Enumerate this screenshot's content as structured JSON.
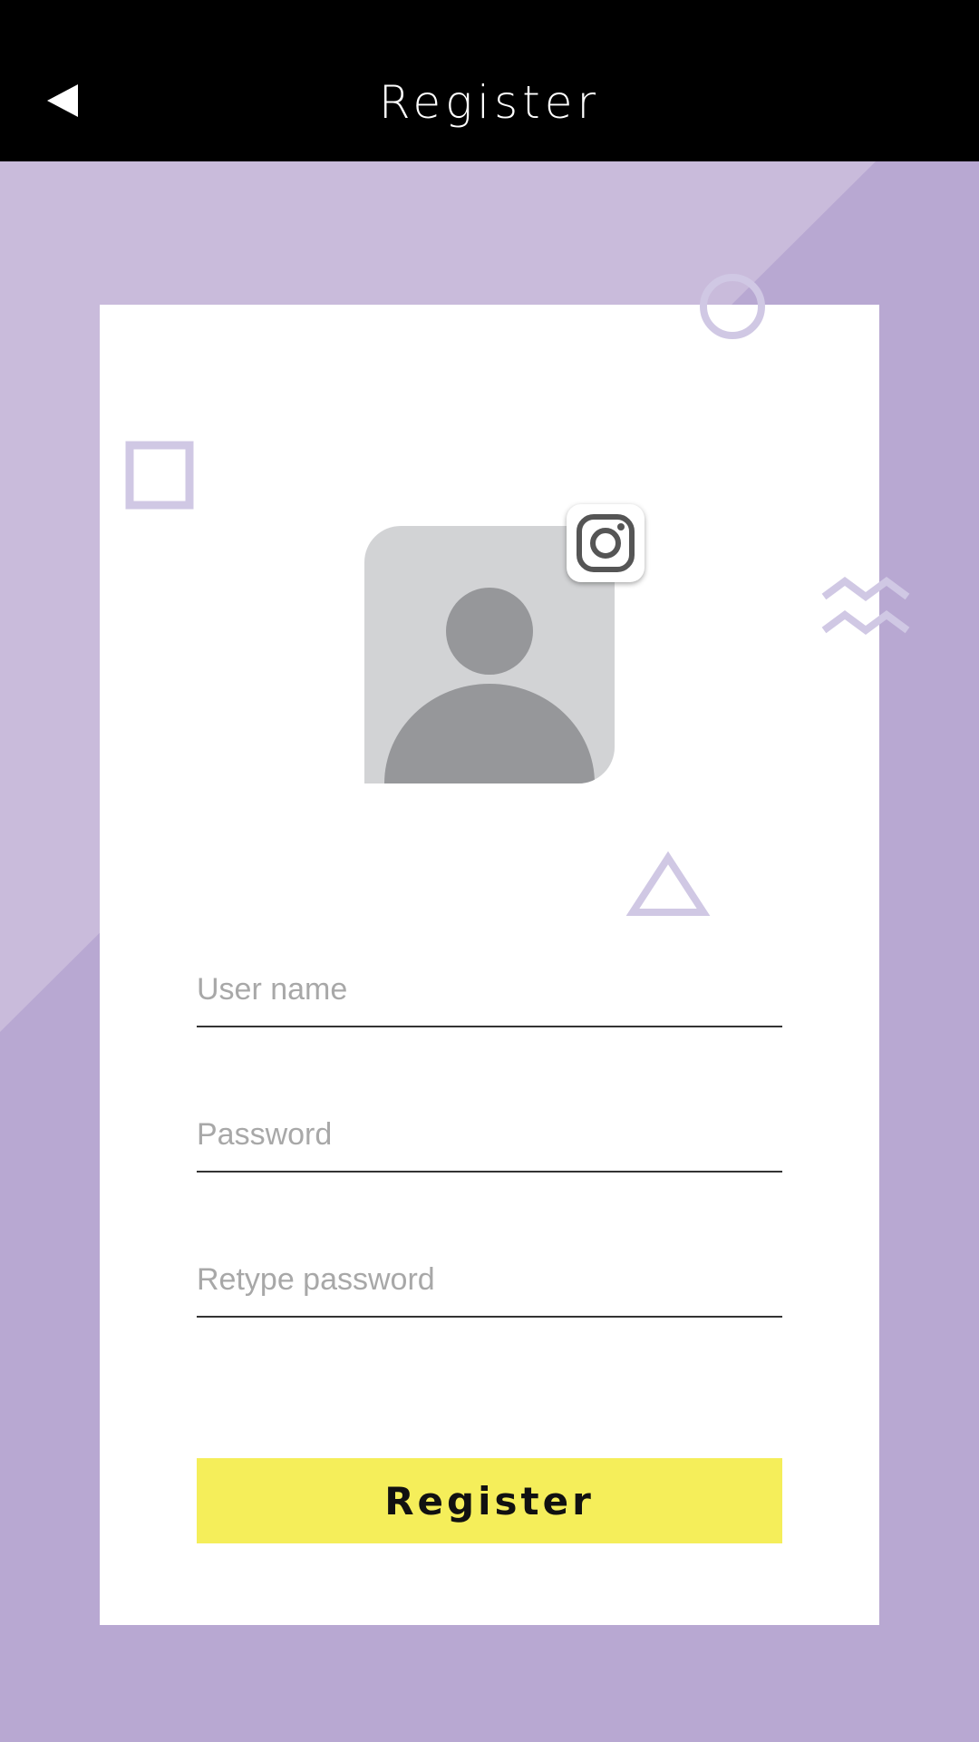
{
  "header": {
    "title": "Register",
    "back_icon": "back-arrow-icon"
  },
  "colors": {
    "header_bg": "#000000",
    "background": "#b8a8d2",
    "background_light": "#c9bbdb",
    "decoration": "#d0c8e4",
    "button": "#f5ee5a",
    "avatar_bg": "#d2d3d5",
    "avatar_fg": "#96979a"
  },
  "profile": {
    "avatar_icon": "user-avatar-icon",
    "badge_icon": "instagram-icon"
  },
  "form": {
    "username": {
      "placeholder": "User name",
      "value": ""
    },
    "password": {
      "placeholder": "Password",
      "value": ""
    },
    "retype_password": {
      "placeholder": "Retype password",
      "value": ""
    },
    "submit_label": "Register"
  }
}
